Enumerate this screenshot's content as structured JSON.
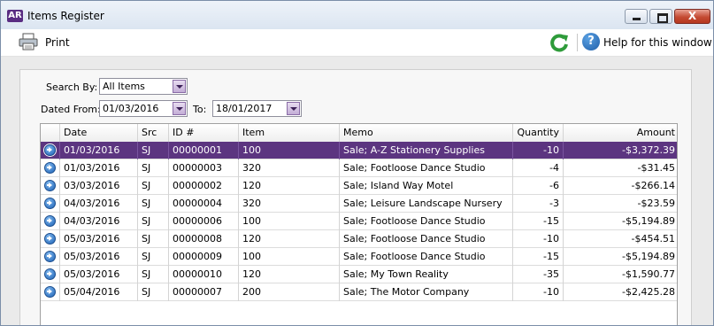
{
  "window": {
    "logo": "AR",
    "title": "Items Register",
    "close_glyph": "X"
  },
  "toolbar": {
    "print_label": "Print",
    "help_label": "Help for this window",
    "help_glyph": "?"
  },
  "filters": {
    "search_by_label": "Search By:",
    "search_by_value": "All Items",
    "dated_from_label": "Dated From:",
    "dated_from_value": "01/03/2016",
    "to_label": "To:",
    "to_value": "18/01/2017"
  },
  "table": {
    "columns": [
      "Date",
      "Src",
      "ID #",
      "Item",
      "Memo",
      "Quantity",
      "Amount"
    ],
    "rows": [
      {
        "date": "01/03/2016",
        "src": "SJ",
        "id": "00000001",
        "item": "100",
        "memo": "Sale; A-Z Stationery Supplies",
        "qty": "-10",
        "amount": "-$3,372.39",
        "selected": true
      },
      {
        "date": "01/03/2016",
        "src": "SJ",
        "id": "00000003",
        "item": "320",
        "memo": "Sale; Footloose Dance Studio",
        "qty": "-4",
        "amount": "-$31.45"
      },
      {
        "date": "03/03/2016",
        "src": "SJ",
        "id": "00000002",
        "item": "120",
        "memo": "Sale; Island Way Motel",
        "qty": "-6",
        "amount": "-$266.14"
      },
      {
        "date": "04/03/2016",
        "src": "SJ",
        "id": "00000004",
        "item": "320",
        "memo": "Sale; Leisure Landscape Nursery",
        "qty": "-3",
        "amount": "-$23.59"
      },
      {
        "date": "04/03/2016",
        "src": "SJ",
        "id": "00000006",
        "item": "100",
        "memo": "Sale; Footloose Dance Studio",
        "qty": "-15",
        "amount": "-$5,194.89"
      },
      {
        "date": "05/03/2016",
        "src": "SJ",
        "id": "00000008",
        "item": "120",
        "memo": "Sale; Footloose Dance Studio",
        "qty": "-10",
        "amount": "-$454.51"
      },
      {
        "date": "05/03/2016",
        "src": "SJ",
        "id": "00000009",
        "item": "100",
        "memo": "Sale; Footloose Dance Studio",
        "qty": "-15",
        "amount": "-$5,194.89"
      },
      {
        "date": "05/03/2016",
        "src": "SJ",
        "id": "00000010",
        "item": "120",
        "memo": "Sale; My Town Reality",
        "qty": "-35",
        "amount": "-$1,590.77"
      },
      {
        "date": "05/04/2016",
        "src": "SJ",
        "id": "00000007",
        "item": "200",
        "memo": "Sale; The Motor Company",
        "qty": "-10",
        "amount": "-$2,425.28"
      }
    ]
  },
  "colors": {
    "selection": "#5c3580",
    "accent_purple": "#5a2d82",
    "refresh_green": "#2e9b3a"
  },
  "icons": [
    "app-logo-icon",
    "minimize-icon",
    "maximize-icon",
    "close-icon",
    "printer-icon",
    "refresh-icon",
    "help-icon",
    "dropdown-arrow-icon",
    "row-zoom-arrow-icon"
  ]
}
